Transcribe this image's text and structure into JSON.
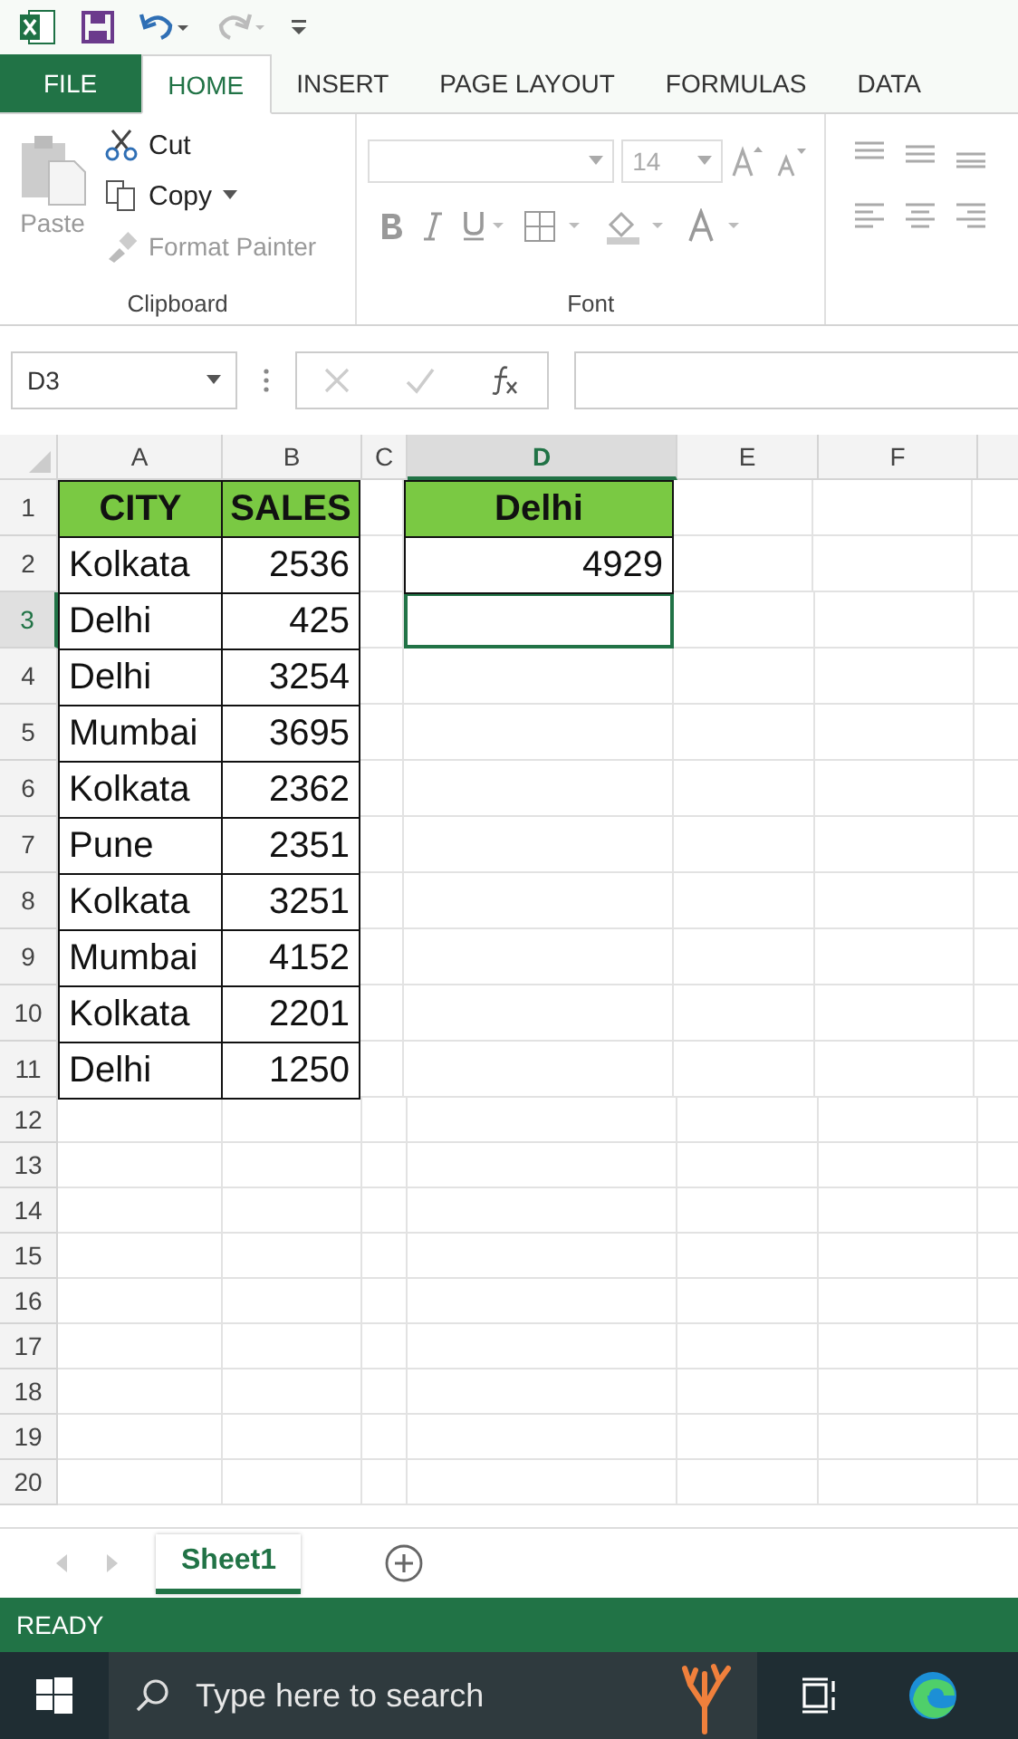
{
  "ribbon_tabs": [
    {
      "label": "FILE",
      "kind": "file",
      "selected": false
    },
    {
      "label": "HOME",
      "kind": "tab",
      "selected": true
    },
    {
      "label": "INSERT",
      "kind": "tab",
      "selected": false
    },
    {
      "label": "PAGE LAYOUT",
      "kind": "tab",
      "selected": false
    },
    {
      "label": "FORMULAS",
      "kind": "tab",
      "selected": false
    },
    {
      "label": "DATA",
      "kind": "tab",
      "selected": false
    }
  ],
  "clipboard": {
    "paste": "Paste",
    "cut": "Cut",
    "copy": "Copy",
    "format_painter": "Format Painter",
    "label": "Clipboard"
  },
  "font": {
    "size": "14",
    "label": "Font"
  },
  "name_box": "D3",
  "columns": [
    {
      "label": "A",
      "selected": false
    },
    {
      "label": "B",
      "selected": false
    },
    {
      "label": "C",
      "selected": false
    },
    {
      "label": "D",
      "selected": true
    },
    {
      "label": "E",
      "selected": false
    },
    {
      "label": "F",
      "selected": false
    }
  ],
  "rows": [
    {
      "number": "1",
      "selected": false,
      "header": true,
      "a": "CITY",
      "b": "SALES",
      "d": "Delhi"
    },
    {
      "number": "2",
      "selected": false,
      "a": "Kolkata",
      "b": "2536",
      "d": "4929"
    },
    {
      "number": "3",
      "selected": true,
      "a": "Delhi",
      "b": "425"
    },
    {
      "number": "4",
      "selected": false,
      "a": "Delhi",
      "b": "3254"
    },
    {
      "number": "5",
      "selected": false,
      "a": "Mumbai",
      "b": "3695"
    },
    {
      "number": "6",
      "selected": false,
      "a": "Kolkata",
      "b": "2362"
    },
    {
      "number": "7",
      "selected": false,
      "a": "Pune",
      "b": "2351"
    },
    {
      "number": "8",
      "selected": false,
      "a": "Kolkata",
      "b": "3251"
    },
    {
      "number": "9",
      "selected": false,
      "a": "Mumbai",
      "b": "4152"
    },
    {
      "number": "10",
      "selected": false,
      "a": "Kolkata",
      "b": "2201"
    },
    {
      "number": "11",
      "selected": false,
      "a": "Delhi",
      "b": "1250"
    },
    {
      "number": "12",
      "selected": false
    },
    {
      "number": "13",
      "selected": false
    },
    {
      "number": "14",
      "selected": false
    },
    {
      "number": "15",
      "selected": false
    },
    {
      "number": "16",
      "selected": false
    },
    {
      "number": "17",
      "selected": false
    },
    {
      "number": "18",
      "selected": false
    },
    {
      "number": "19",
      "selected": false
    },
    {
      "number": "20",
      "selected": false
    }
  ],
  "sheet_tabs": [
    {
      "label": "Sheet1",
      "selected": true
    }
  ],
  "status": "READY",
  "taskbar": {
    "search_placeholder": "Type here to search"
  }
}
